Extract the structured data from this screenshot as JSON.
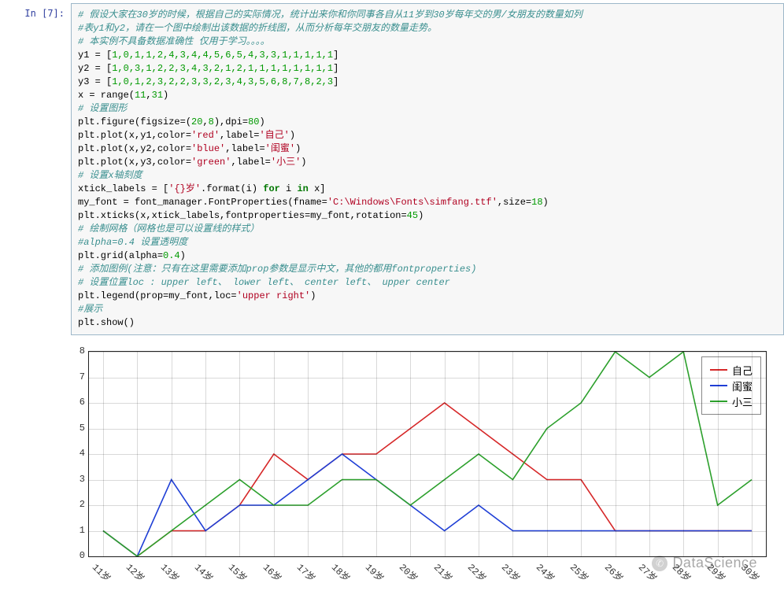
{
  "prompt": "In  [7]:",
  "code": {
    "l1": "# 假设大家在30岁的时候，根据自己的实际情况，统计出来你和你同事各自从11岁到30岁每年交的男/女朋友的数量如列",
    "l2": "#表y1和y2，请在一个图中绘制出该数据的折线图，从而分析每年交朋友的数量走势。",
    "l3": "# 本实例不具备数据准确性 仅用于学习。。。。",
    "l4a": "y1 = [",
    "l4b": "1,0,1,1,2,4,3,4,4,5,6,5,4,3,3,1,1,1,1,1",
    "l4c": "]",
    "l5a": "y2 = [",
    "l5b": "1,0,3,1,2,2,3,4,3,2,1,2,1,1,1,1,1,1,1,1",
    "l5c": "]",
    "l6a": "y3 = [",
    "l6b": "1,0,1,2,3,2,2,3,3,2,3,4,3,5,6,8,7,8,2,3",
    "l6c": "]",
    "l7a": "x = range(",
    "l7b": "11",
    "l7c": ",",
    "l7d": "31",
    "l7e": ")",
    "l8": "# 设置图形",
    "l9a": "plt.figure(figsize=(",
    "l9b": "20",
    "l9c": ",",
    "l9d": "8",
    "l9e": "),dpi=",
    "l9f": "80",
    "l9g": ")",
    "l10a": "plt.plot(x,y1,color=",
    "l10b": "'red'",
    "l10c": ",label=",
    "l10d": "'自己'",
    "l10e": ")",
    "l11a": "plt.plot(x,y2,color=",
    "l11b": "'blue'",
    "l11c": ",label=",
    "l11d": "'闺蜜'",
    "l11e": ")",
    "l12a": "plt.plot(x,y3,color=",
    "l12b": "'green'",
    "l12c": ",label=",
    "l12d": "'小三'",
    "l12e": ")",
    "l13": "# 设置x轴刻度",
    "l14a": "xtick_labels = [",
    "l14b": "'{}岁'",
    "l14c": ".format(i) ",
    "l14d": "for",
    "l14e": " i ",
    "l14f": "in",
    "l14g": " x]",
    "l15a": "my_font = font_manager.FontProperties(fname=",
    "l15b": "'C:\\Windows\\Fonts\\simfang.ttf'",
    "l15c": ",size=",
    "l15d": "18",
    "l15e": ")",
    "l16a": "plt.xticks(x,xtick_labels,fontproperties=my_font,rotation=",
    "l16b": "45",
    "l16c": ")",
    "l17": "# 绘制网格（网格也是可以设置线的样式）",
    "l18": "#alpha=0.4 设置透明度",
    "l19a": "plt.grid(alpha=",
    "l19b": "0.4",
    "l19c": ")",
    "l20": "# 添加图例(注意：只有在这里需要添加prop参数是显示中文，其他的都用fontproperties)",
    "l21": "# 设置位置loc : upper left、 lower left、 center left、 upper center",
    "l22a": "plt.legend(prop=my_font,loc=",
    "l22b": "'upper right'",
    "l22c": ")",
    "l23": "#展示",
    "l24": "plt.show()"
  },
  "chart_data": {
    "type": "line",
    "xlabel": "",
    "ylabel": "",
    "ylim": [
      0,
      8
    ],
    "yticks": [
      0,
      1,
      2,
      3,
      4,
      5,
      6,
      7,
      8
    ],
    "categories": [
      "11岁",
      "12岁",
      "13岁",
      "14岁",
      "15岁",
      "16岁",
      "17岁",
      "18岁",
      "19岁",
      "20岁",
      "21岁",
      "22岁",
      "23岁",
      "24岁",
      "25岁",
      "26岁",
      "27岁",
      "28岁",
      "29岁",
      "30岁"
    ],
    "series": [
      {
        "name": "自己",
        "color": "#d62728",
        "values": [
          1,
          0,
          1,
          1,
          2,
          4,
          3,
          4,
          4,
          5,
          6,
          5,
          4,
          3,
          3,
          1,
          1,
          1,
          1,
          1
        ]
      },
      {
        "name": "闺蜜",
        "color": "#1f3fd6",
        "values": [
          1,
          0,
          3,
          1,
          2,
          2,
          3,
          4,
          3,
          2,
          1,
          2,
          1,
          1,
          1,
          1,
          1,
          1,
          1,
          1
        ]
      },
      {
        "name": "小三",
        "color": "#2ca02c",
        "values": [
          1,
          0,
          1,
          2,
          3,
          2,
          2,
          3,
          3,
          2,
          3,
          4,
          3,
          5,
          6,
          8,
          7,
          8,
          2,
          3
        ]
      }
    ],
    "legend_loc": "upper right",
    "grid": true
  },
  "watermark": "DataScience"
}
